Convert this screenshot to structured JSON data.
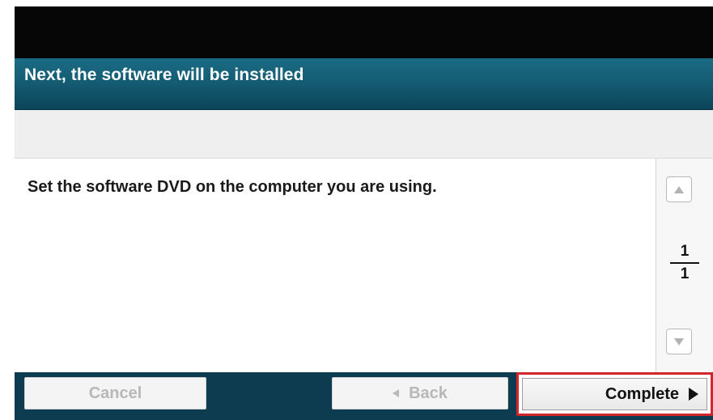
{
  "header": {
    "title": "Next, the software will be installed"
  },
  "content": {
    "message": "Set the software DVD on the computer you are using."
  },
  "pager": {
    "current_page": "1",
    "total_pages": "1",
    "up_icon": "up-triangle",
    "down_icon": "down-triangle"
  },
  "footer": {
    "cancel_label": "Cancel",
    "back_label": "Back",
    "complete_label": "Complete",
    "back_icon": "left-triangle",
    "complete_icon": "right-triangle"
  },
  "colors": {
    "title_bar": "#145d74",
    "footer": "#0d3b4f",
    "highlight": "#d2262c",
    "disabled_text": "#b8b8b8"
  }
}
